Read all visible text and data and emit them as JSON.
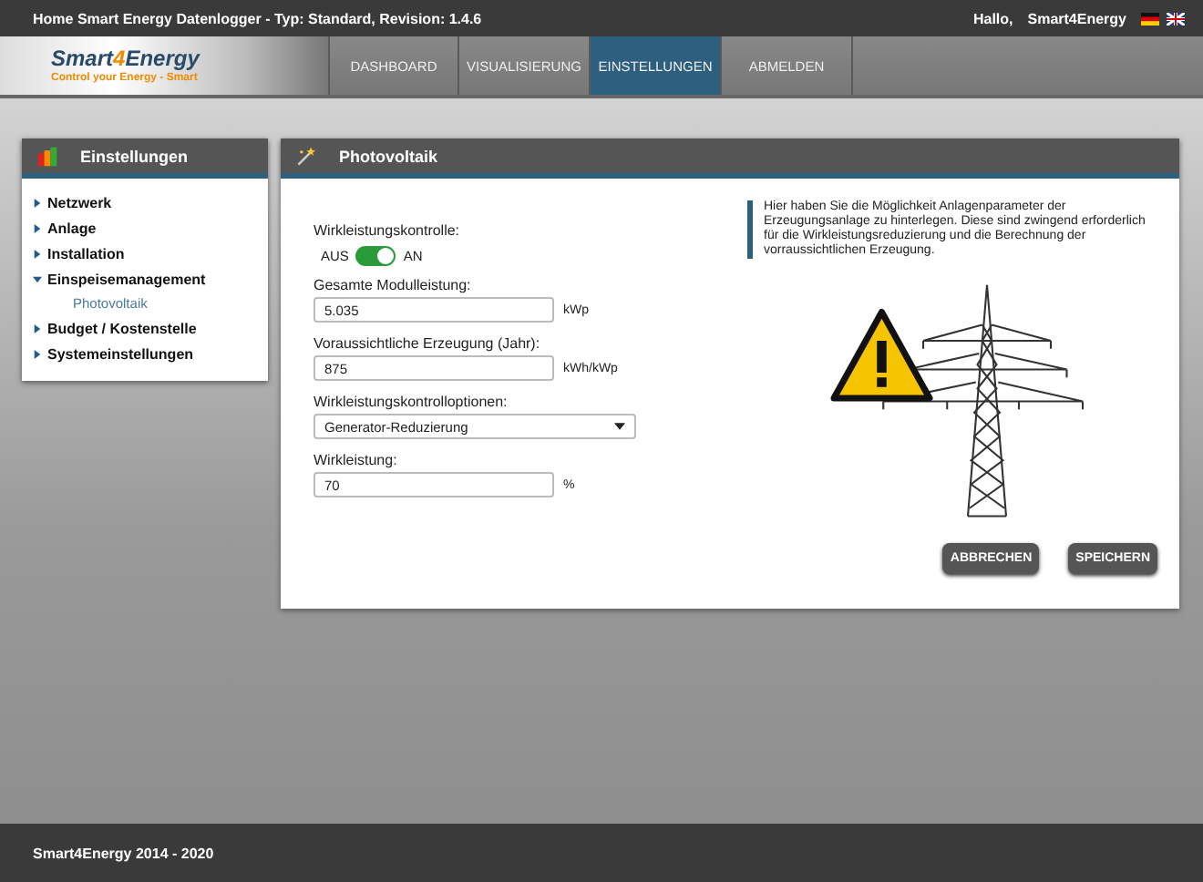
{
  "top_bar": {
    "title": "Home Smart Energy Datenlogger - Typ: Standard, Revision: 1.4.6",
    "greeting": "Hallo,",
    "user": "Smart4Energy"
  },
  "logo": {
    "name_start": "Smart",
    "name_digit": "4",
    "name_end": "Energy",
    "slogan": "Control your Energy - Smart"
  },
  "nav_tabs": [
    {
      "label": "DASHBOARD",
      "selected": false
    },
    {
      "label": "VISUALISIERUNG",
      "selected": false
    },
    {
      "label": "EINSTELLUNGEN",
      "selected": true
    },
    {
      "label": "ABMELDEN",
      "selected": false
    }
  ],
  "sidebar": {
    "title": "Einstellungen",
    "items": [
      {
        "label": "Netzwerk",
        "expanded": false
      },
      {
        "label": "Anlage",
        "expanded": false
      },
      {
        "label": "Installation",
        "expanded": false
      },
      {
        "label": "Einspeisemanagement",
        "expanded": true,
        "children": [
          {
            "label": "Photovoltaik",
            "selected": true
          }
        ]
      },
      {
        "label": "Budget / Kostenstelle",
        "expanded": false
      },
      {
        "label": "Systemeinstellungen",
        "expanded": false
      }
    ]
  },
  "panel": {
    "title": "Photovoltaik",
    "toggle": {
      "label": "Wirkleistungskontrolle:",
      "off_label": "AUS",
      "on_label": "AN",
      "on": true
    },
    "fields": [
      {
        "kind": "input",
        "label": "Gesamte Modulleistung:",
        "value": "5.035",
        "unit": "kWp"
      },
      {
        "kind": "input",
        "label": "Voraussichtliche Erzeugung (Jahr):",
        "value": "875",
        "unit": "kWh/kWp"
      },
      {
        "kind": "select",
        "label": "Wirkleistungskontrolloptionen:",
        "value": "Generator-Reduzierung"
      },
      {
        "kind": "input",
        "label": "Wirkleistung:",
        "value": "70",
        "unit": "%"
      }
    ],
    "info": "Hier haben Sie die Möglichkeit Anlagenparameter der Erzeugungsanlage zu hinterlegen. Diese sind zwingend erforderlich für die Wirkleistungsreduzierung und die Berechnung der vorraussichtlichen Erzeugung.",
    "buttons": [
      "ABBRECHEN",
      "SPEICHERN"
    ]
  },
  "footer": "Smart4Energy 2014 - 2020"
}
